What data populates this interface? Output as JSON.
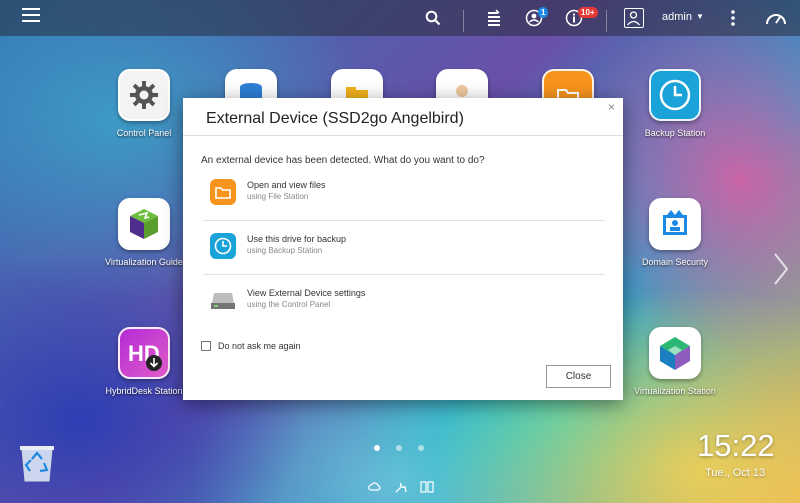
{
  "topbar": {
    "menu_icon": "hamburger-menu-icon",
    "search_icon": "search-icon",
    "task_icon": "background-tasks-icon",
    "task_badge_icon": "notifications-user-icon",
    "task_badge": "1",
    "info_icon": "event-notification-icon",
    "info_badge": "10+",
    "user_icon": "user-icon",
    "username": "admin",
    "more_icon": "more-options-icon",
    "dashboard_icon": "dashboard-gauge-icon"
  },
  "desktop": {
    "apps": [
      {
        "label": "Control Panel",
        "icon": "gear-icon"
      },
      {
        "label": "Backup Station",
        "icon": "backup-clock-icon"
      },
      {
        "label": "Virtualization Guide",
        "icon": "cube-icon"
      },
      {
        "label": "Domain Security",
        "icon": "domain-id-icon"
      },
      {
        "label": "HybridDesk Station",
        "icon": "hd-download-icon"
      },
      {
        "label": "Virtualization Station",
        "icon": "gem-cube-icon"
      }
    ],
    "hidden_apps": [
      "storage-icon",
      "file-folder-icon",
      "user-profile-icon",
      "orange-folder-icon"
    ],
    "clock": {
      "time": "15:22",
      "date": "Tue., Oct 13"
    },
    "pages": 3,
    "active_page": 1
  },
  "dialog": {
    "title": "External Device (SSD2go Angelbird)",
    "prompt": "An external device has been detected. What do you want to do?",
    "options": [
      {
        "title": "Open and view files",
        "subtitle": "using File Station",
        "icon": "file-station-icon"
      },
      {
        "title": "Use this drive for backup",
        "subtitle": "using Backup Station",
        "icon": "backup-station-icon"
      },
      {
        "title": "View External Device settings",
        "subtitle": "using the Control Panel",
        "icon": "external-drive-icon"
      }
    ],
    "checkbox_label": "Do not ask me again",
    "checkbox_checked": false,
    "close_button": "Close",
    "close_icon": "×"
  },
  "colors": {
    "badge_blue": "#1e88e5",
    "badge_red": "#e53935",
    "file_station_orange": "#f7941d",
    "backup_teal": "#1aa3d9"
  }
}
